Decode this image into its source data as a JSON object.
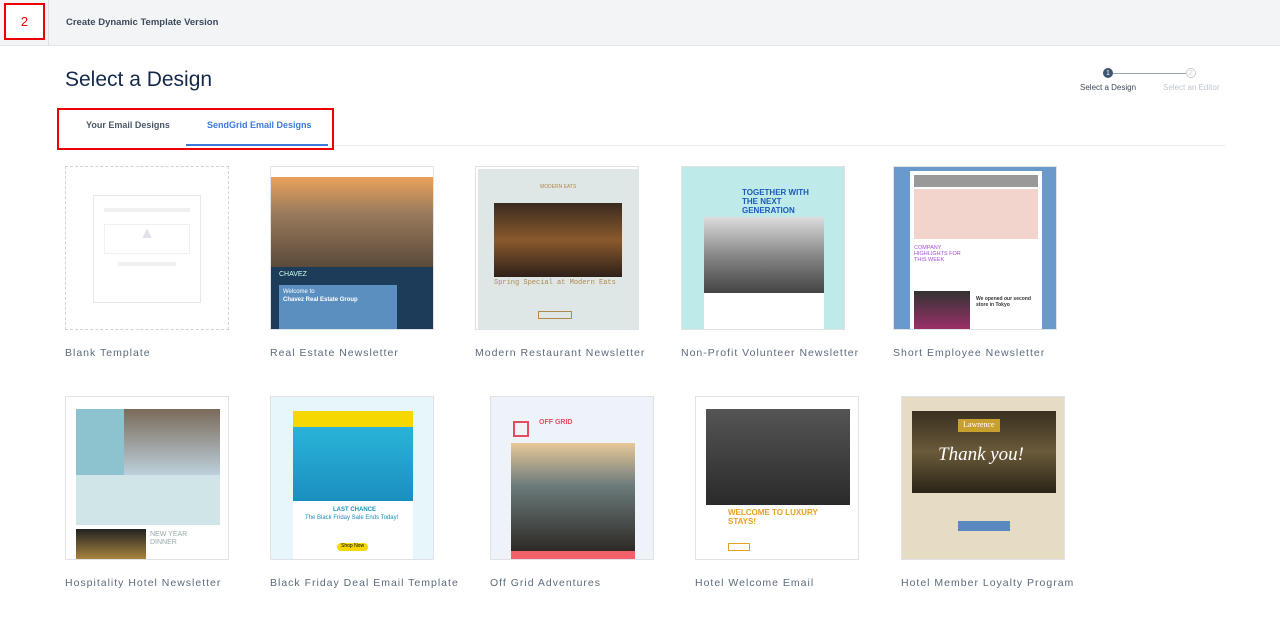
{
  "header": {
    "step_badge": "2",
    "title": "Create Dynamic Template Version"
  },
  "page_title": "Select a Design",
  "wizard": {
    "steps": [
      {
        "num": "1",
        "label": "Select a Design",
        "active": true
      },
      {
        "num": "2",
        "label": "Select an Editor",
        "active": false
      }
    ]
  },
  "tabs": [
    {
      "label": "Your Email Designs",
      "active": false
    },
    {
      "label": "SendGrid Email Designs",
      "active": true
    }
  ],
  "colors": {
    "accent": "#3f78d8",
    "title": "#13294b",
    "highlight": "#ee0000"
  },
  "templates": [
    {
      "name": "Blank Template"
    },
    {
      "name": "Real Estate Newsletter",
      "thumb": [
        "CHAVEZ",
        "Welcome to",
        "Chavez Real Estate Group"
      ]
    },
    {
      "name": "Modern Restaurant Newsletter",
      "thumb": [
        "MODERN EATS",
        "Spring Special at Modern Eats"
      ]
    },
    {
      "name": "Non-Profit Volunteer Newsletter",
      "thumb": [
        "TOGETHER WITH THE NEXT GENERATION"
      ]
    },
    {
      "name": "Short Employee Newsletter",
      "thumb": [
        "COMPANY HIGHLIGHTS FOR THIS WEEK",
        "We opened our second store in Tokyo"
      ]
    },
    {
      "name": "Hospitality Hotel Newsletter",
      "thumb": [
        "NEW YEAR DINNER"
      ]
    },
    {
      "name": "Black Friday Deal Email Template",
      "thumb": [
        "LAST CHANCE",
        "The Black Friday Sale Ends Today!",
        "Shop Now"
      ]
    },
    {
      "name": "Off Grid Adventures",
      "thumb": [
        "OFF GRID"
      ]
    },
    {
      "name": "Hotel Welcome Email",
      "thumb": [
        "WELCOME TO LUXURY STAYS!"
      ]
    },
    {
      "name": "Hotel Member Loyalty Program",
      "thumb": [
        "Lawrence",
        "Thank you!"
      ]
    }
  ]
}
